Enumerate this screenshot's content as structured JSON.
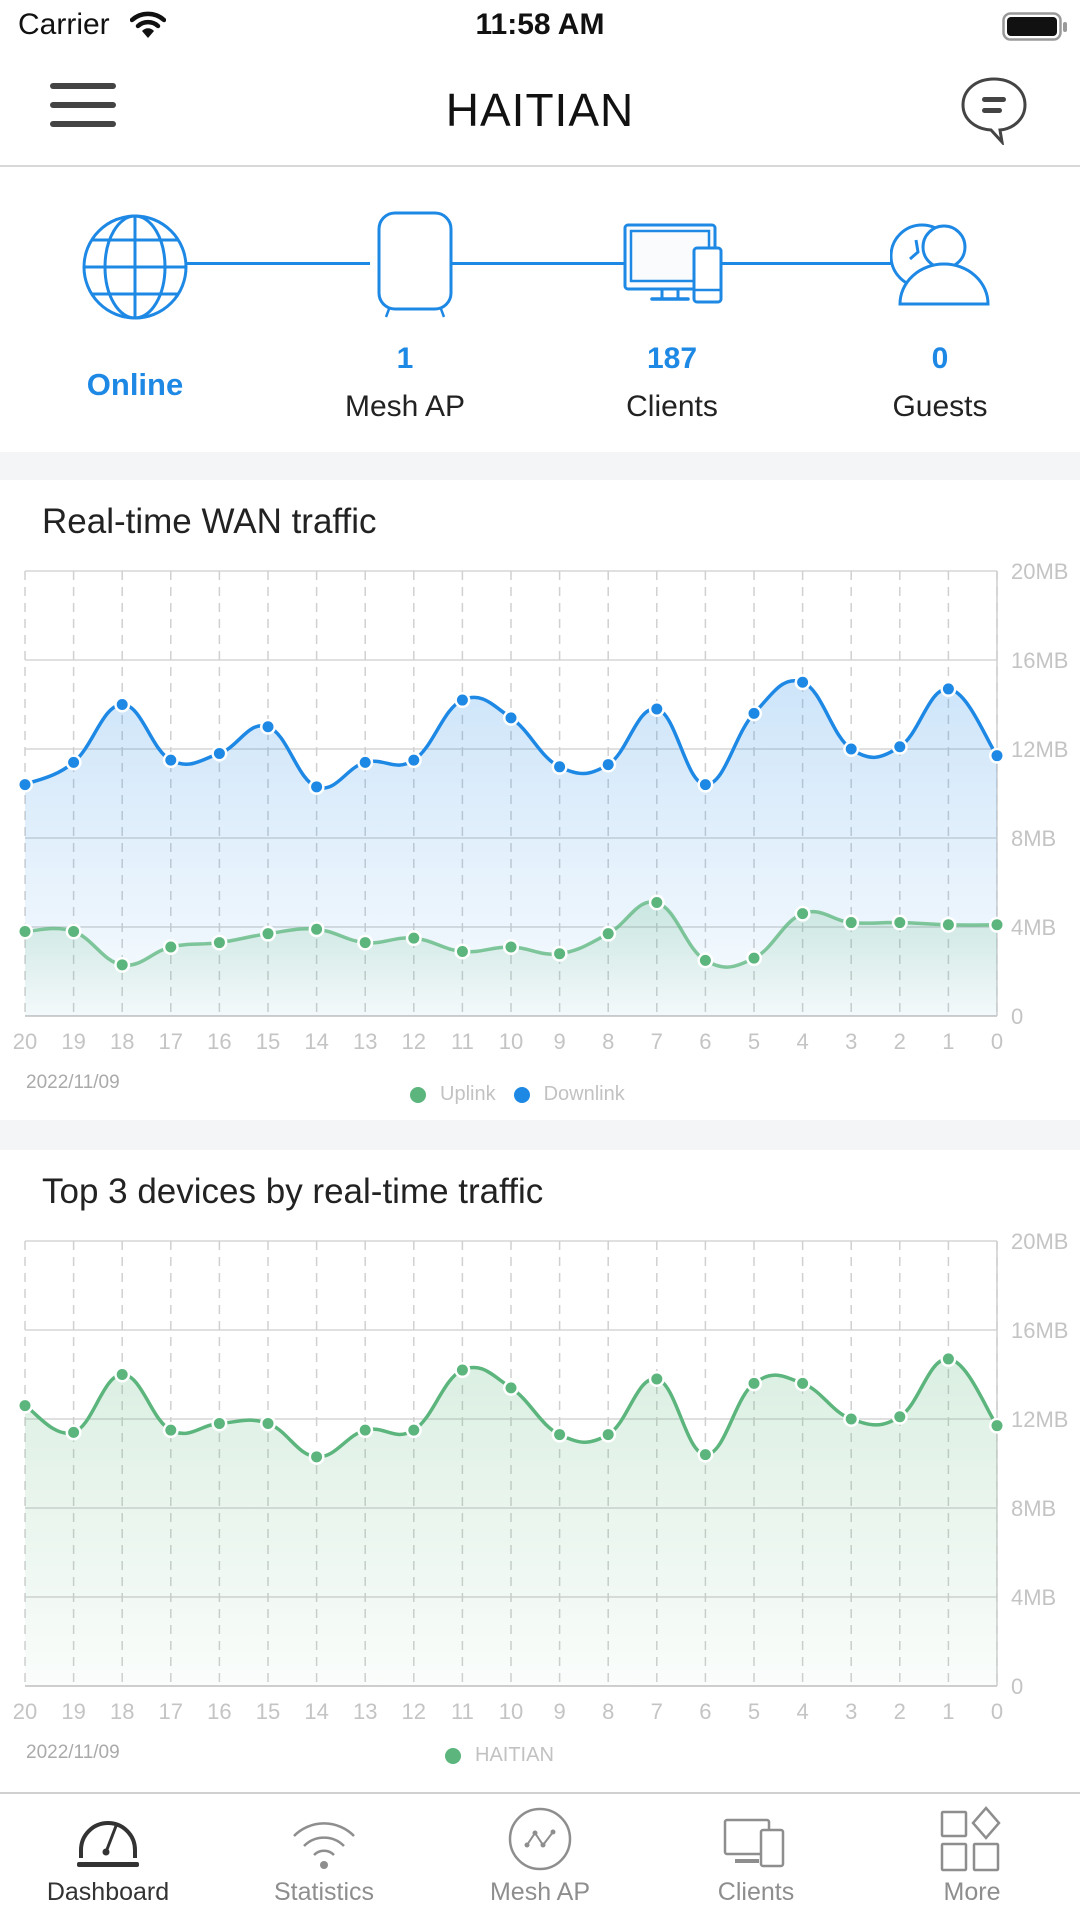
{
  "status_bar": {
    "carrier": "Carrier",
    "time": "11:58 AM"
  },
  "nav": {
    "title": "HAITIAN"
  },
  "topology": {
    "internet": {
      "status": "Online"
    },
    "mesh_ap": {
      "count": "1",
      "label": "Mesh AP"
    },
    "clients": {
      "count": "187",
      "label": "Clients"
    },
    "guests": {
      "count": "0",
      "label": "Guests"
    }
  },
  "colors": {
    "accent": "#1e88e5",
    "uplink": "#5bb57c",
    "downlink": "#1e88e5",
    "device": "#5bb57c"
  },
  "wan_card": {
    "title": "Real-time WAN traffic",
    "date": "2022/11/09"
  },
  "top_card": {
    "title": "Top 3 devices by real-time traffic",
    "date": "2022/11/09"
  },
  "chart_data": [
    {
      "type": "area",
      "title": "Real-time WAN traffic",
      "xlabel": "",
      "ylabel": "",
      "x": [
        "20",
        "19",
        "18",
        "17",
        "16",
        "15",
        "14",
        "13",
        "12",
        "11",
        "10",
        "9",
        "8",
        "7",
        "6",
        "5",
        "4",
        "3",
        "2",
        "1",
        "0"
      ],
      "y_ticks": [
        "0",
        "4MB",
        "8MB",
        "12MB",
        "16MB",
        "20MB"
      ],
      "ylim": [
        0,
        20
      ],
      "y_unit": "MB",
      "grid": true,
      "legend_position": "bottom-center",
      "series": [
        {
          "name": "Uplink",
          "color": "#5bb57c",
          "values": [
            3.8,
            3.8,
            2.3,
            3.1,
            3.3,
            3.7,
            3.9,
            3.3,
            3.5,
            2.9,
            3.1,
            2.8,
            3.7,
            5.1,
            2.5,
            2.6,
            4.6,
            4.2,
            4.2,
            4.1,
            4.1
          ]
        },
        {
          "name": "Downlink",
          "color": "#1e88e5",
          "values": [
            10.4,
            11.4,
            14.0,
            11.5,
            11.8,
            13.0,
            10.3,
            11.4,
            11.5,
            14.2,
            13.4,
            11.2,
            11.3,
            13.8,
            10.4,
            13.6,
            15.0,
            12.0,
            12.1,
            14.7,
            11.7
          ]
        }
      ]
    },
    {
      "type": "area",
      "title": "Top 3 devices by real-time traffic",
      "xlabel": "",
      "ylabel": "",
      "x": [
        "20",
        "19",
        "18",
        "17",
        "16",
        "15",
        "14",
        "13",
        "12",
        "11",
        "10",
        "9",
        "8",
        "7",
        "6",
        "5",
        "4",
        "3",
        "2",
        "1",
        "0"
      ],
      "y_ticks": [
        "0",
        "4MB",
        "8MB",
        "12MB",
        "16MB",
        "20MB"
      ],
      "ylim": [
        0,
        20
      ],
      "y_unit": "MB",
      "grid": true,
      "legend_position": "bottom-center",
      "series": [
        {
          "name": "HAITIAN",
          "color": "#5bb57c",
          "values": [
            12.6,
            11.4,
            14.0,
            11.5,
            11.8,
            11.8,
            10.3,
            11.5,
            11.5,
            14.2,
            13.4,
            11.3,
            11.3,
            13.8,
            10.4,
            13.6,
            13.6,
            12.0,
            12.1,
            14.7,
            11.7
          ]
        }
      ]
    }
  ],
  "tab_bar": {
    "tabs": [
      {
        "label": "Dashboard",
        "icon": "dashboard-gauge-icon",
        "active": true
      },
      {
        "label": "Statistics",
        "icon": "wifi-statistics-icon",
        "active": false
      },
      {
        "label": "Mesh AP",
        "icon": "mesh-ap-icon",
        "active": false
      },
      {
        "label": "Clients",
        "icon": "devices-icon",
        "active": false
      },
      {
        "label": "More",
        "icon": "more-grid-icon",
        "active": false
      }
    ]
  }
}
